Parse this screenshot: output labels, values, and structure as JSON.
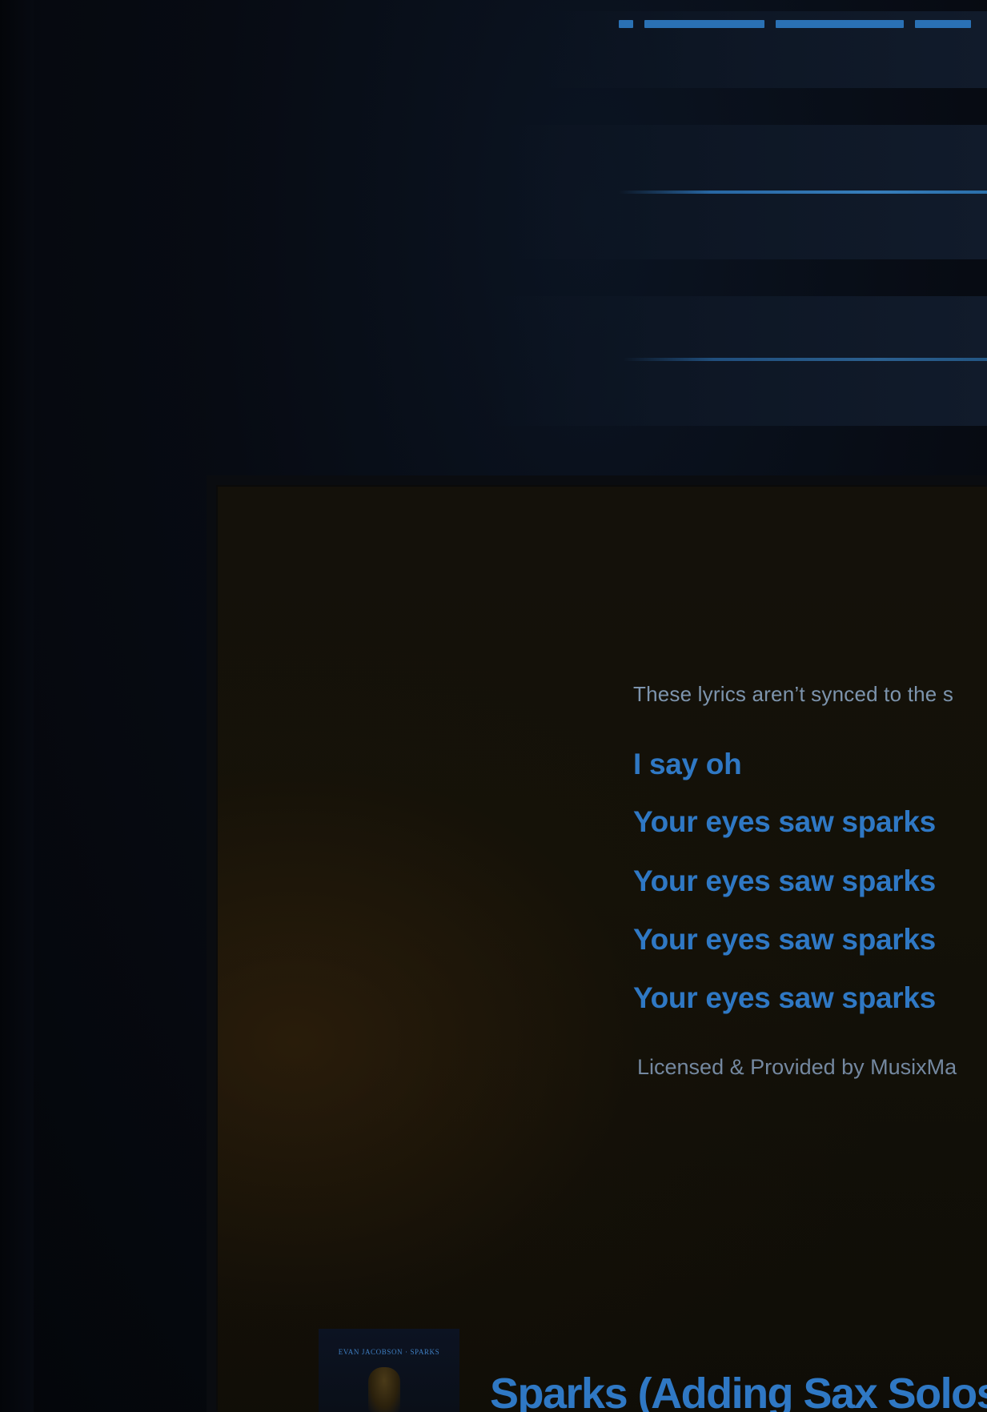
{
  "lyrics_view": {
    "notice": "These lyrics aren’t synced to the s",
    "lines": [
      "I say oh",
      "Your eyes saw sparks",
      "Your eyes saw sparks",
      "Your eyes saw sparks",
      "Your eyes saw sparks"
    ],
    "license": "Licensed & Provided by MusixMa"
  },
  "now_playing": {
    "album_art_caption": "EVAN JACOBSON · SPARKS",
    "title": "Sparks (Adding Sax Solos"
  },
  "colors": {
    "lyric_blue": "#2f78c4",
    "muted_text": "#7d94ad",
    "screen_bg": "#14110a"
  }
}
